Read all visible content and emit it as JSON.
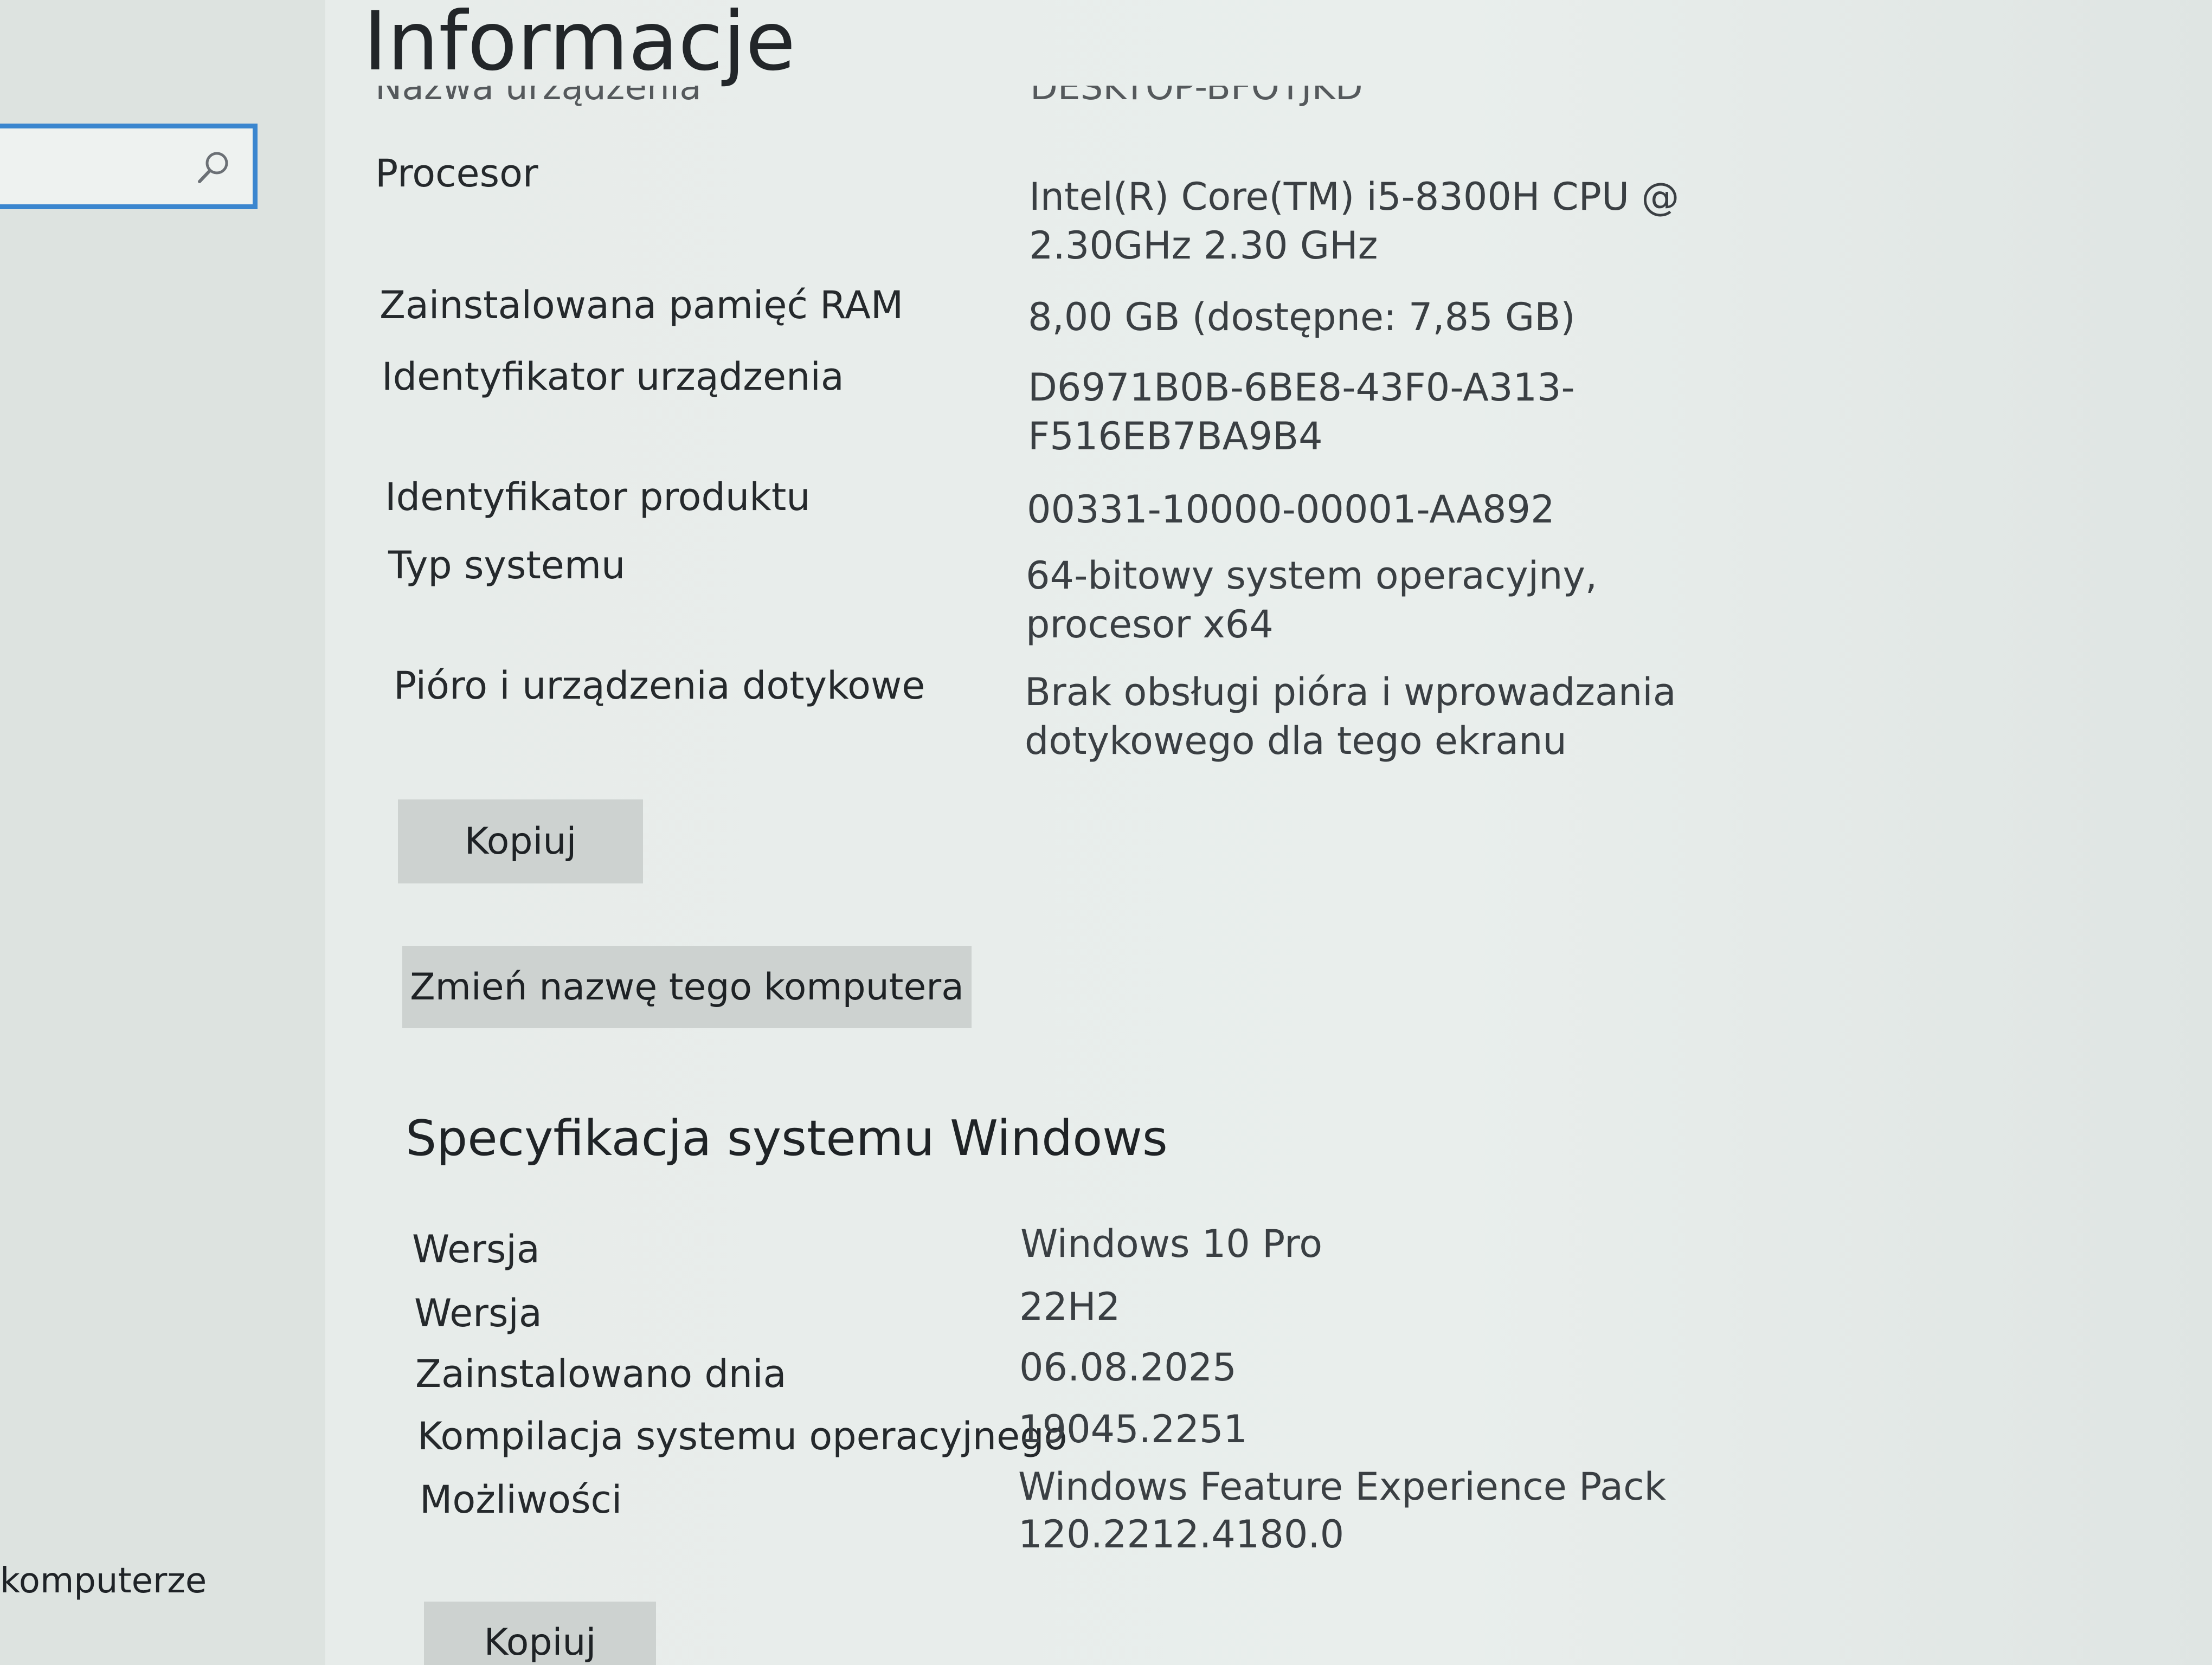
{
  "sidebar": {
    "search": {
      "placeholder": ""
    },
    "bottom_link": "komputerze"
  },
  "page": {
    "title": "Informacje"
  },
  "device": {
    "cut_label": "Nazwa urządzenia",
    "cut_value": "DESKTOP-BFOTJKD",
    "rows": [
      {
        "label": "Procesor",
        "value_line1": "Intel(R) Core(TM) i5-8300H CPU @",
        "value_line2": "2.30GHz   2.30 GHz"
      },
      {
        "label": "Zainstalowana pamięć RAM",
        "value_line1": "8,00 GB (dostępne: 7,85 GB)",
        "value_line2": ""
      },
      {
        "label": "Identyfikator urządzenia",
        "value_line1": "D6971B0B-6BE8-43F0-A313-",
        "value_line2": "F516EB7BA9B4"
      },
      {
        "label": "Identyfikator produktu",
        "value_line1": "00331-10000-00001-AA892",
        "value_line2": ""
      },
      {
        "label": "Typ systemu",
        "value_line1": "64-bitowy system operacyjny,",
        "value_line2": "procesor x64"
      },
      {
        "label": "Pióro i urządzenia dotykowe",
        "value_line1": "Brak obsługi pióra i wprowadzania",
        "value_line2": "dotykowego dla tego ekranu"
      }
    ],
    "copy_button": "Kopiuj",
    "rename_button": "Zmień nazwę tego komputera"
  },
  "windows_spec": {
    "title": "Specyfikacja systemu Windows",
    "rows": [
      {
        "label": "Wersja",
        "value_line1": "Windows 10 Pro",
        "value_line2": ""
      },
      {
        "label": "Wersja",
        "value_line1": "22H2",
        "value_line2": ""
      },
      {
        "label": "Zainstalowano dnia",
        "value_line1": "06.08.2025",
        "value_line2": ""
      },
      {
        "label": "Kompilacja systemu operacyjnego",
        "value_line1": "19045.2251",
        "value_line2": ""
      },
      {
        "label": "Możliwości",
        "value_line1": "Windows Feature Experience Pack",
        "value_line2": "120.2212.4180.0"
      }
    ],
    "copy_button": "Kopiuj"
  }
}
